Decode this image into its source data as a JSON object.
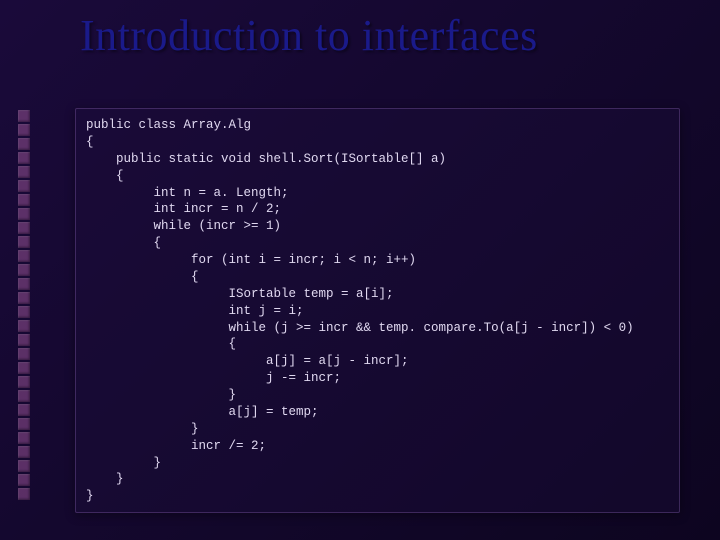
{
  "slide": {
    "title": "Introduction to interfaces",
    "code": "public class Array.Alg\n{\n    public static void shell.Sort(ISortable[] a)\n    {\n         int n = a. Length;\n         int incr = n / 2;\n         while (incr >= 1)\n         {\n              for (int i = incr; i < n; i++)\n              {\n                   ISortable temp = a[i];\n                   int j = i;\n                   while (j >= incr && temp. compare.To(a[j - incr]) < 0)\n                   {\n                        a[j] = a[j - incr];\n                        j -= incr;\n                   }\n                   a[j] = temp;\n              }\n              incr /= 2;\n         }\n    }\n}"
  }
}
